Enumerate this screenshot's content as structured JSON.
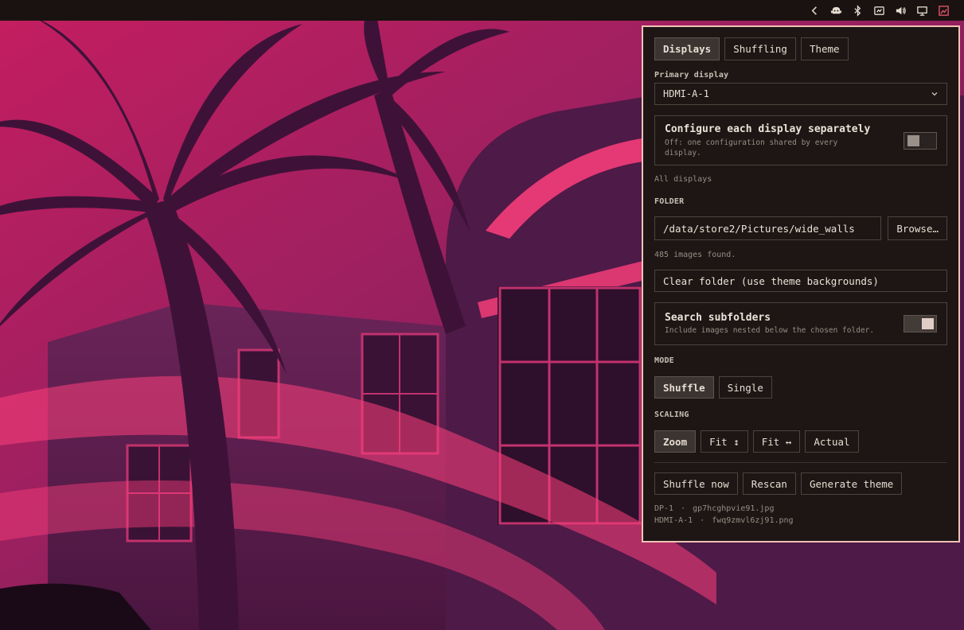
{
  "tray": {
    "icons": [
      "chevron-left-icon",
      "robot-icon",
      "bluetooth-icon",
      "window-icon",
      "speaker-icon",
      "display-icon",
      "wallpaper-icon"
    ]
  },
  "tabs": [
    {
      "label": "Displays",
      "selected": true
    },
    {
      "label": "Shuffling",
      "selected": false
    },
    {
      "label": "Theme",
      "selected": false
    }
  ],
  "primary_display": {
    "label": "Primary display",
    "value": "HDMI-A-1"
  },
  "configure_separately": {
    "title": "Configure each display separately",
    "subtitle_line1": "Off: one configuration shared by every",
    "subtitle_line2": "display.",
    "enabled": false
  },
  "scope_label": "All displays",
  "folder": {
    "label": "FOLDER",
    "path": "/data/store2/Pictures/wide_walls",
    "browse_label": "Browse…",
    "status": "485 images found.",
    "clear_label": "Clear folder (use theme backgrounds)"
  },
  "subfolders": {
    "title": "Search subfolders",
    "subtitle": "Include images nested below the chosen folder.",
    "enabled": true
  },
  "mode": {
    "label": "MODE",
    "options": [
      {
        "label": "Shuffle",
        "selected": true
      },
      {
        "label": "Single",
        "selected": false
      }
    ]
  },
  "scaling": {
    "label": "SCALING",
    "options": [
      {
        "label": "Zoom",
        "selected": true
      },
      {
        "label": "Fit ↕",
        "selected": false
      },
      {
        "label": "Fit ↔",
        "selected": false
      },
      {
        "label": "Actual",
        "selected": false
      }
    ]
  },
  "actions": {
    "shuffle_now": "Shuffle now",
    "rescan": "Rescan",
    "generate_theme": "Generate theme"
  },
  "current_wallpapers": [
    {
      "display": "DP-1",
      "sep": "·",
      "file": "gp7hcghpvie91.jpg"
    },
    {
      "display": "HDMI-A-1",
      "sep": "·",
      "file": "fwq9zmvl6zj91.png"
    }
  ],
  "colors": {
    "panel_bg": "#1d1614",
    "panel_border": "#f1c2b6",
    "topbar_bg": "#1a1210",
    "accent": "#e8566a"
  }
}
